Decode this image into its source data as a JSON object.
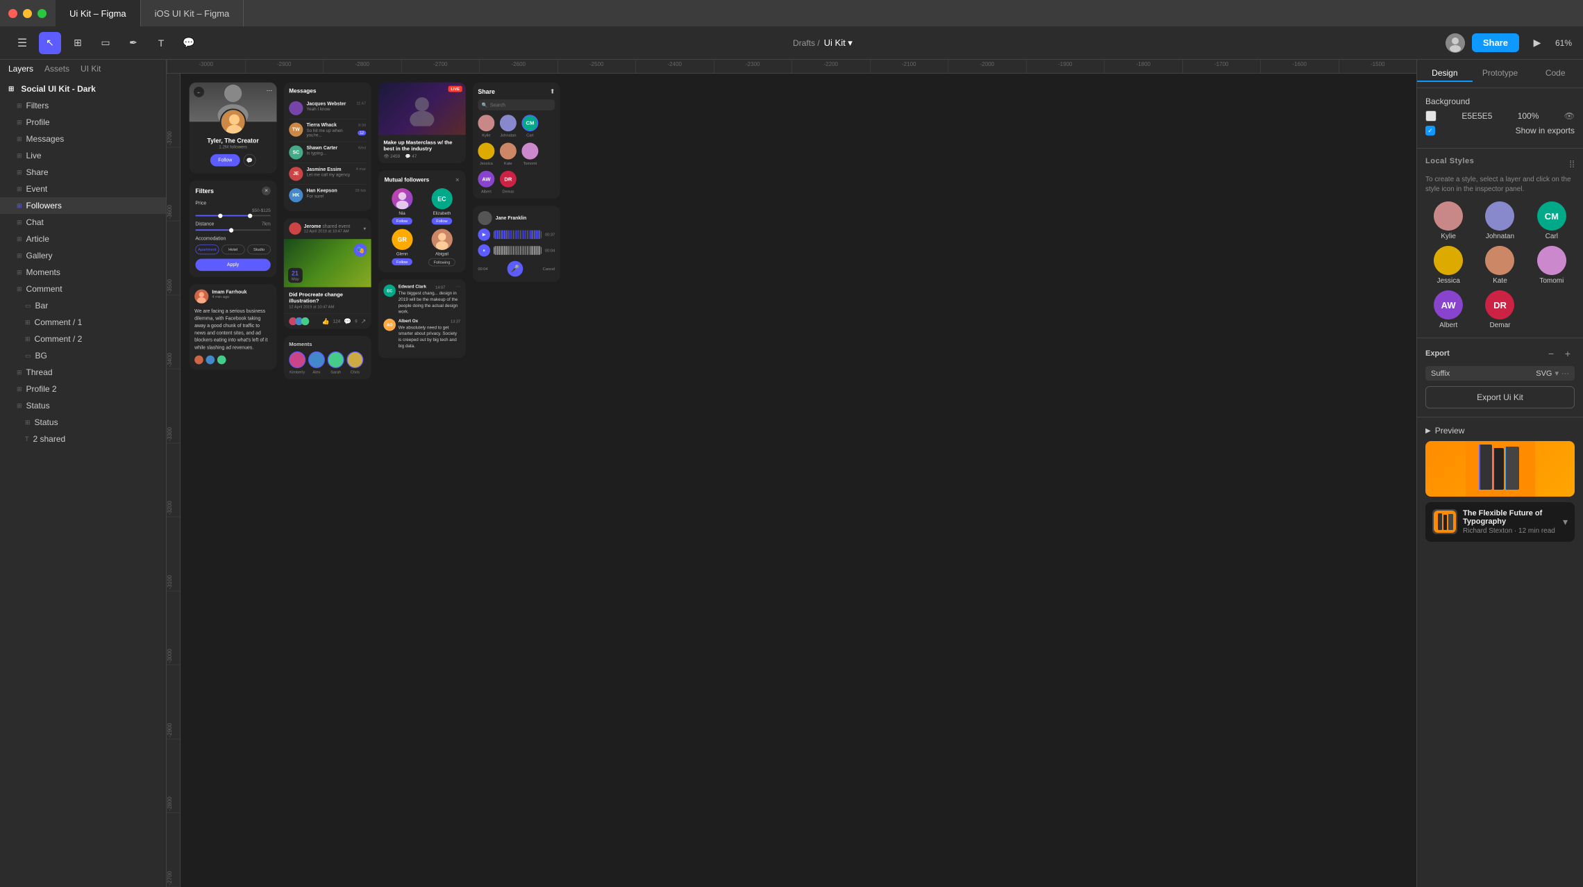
{
  "titlebar": {
    "tab1": "Ui Kit – Figma",
    "tab2": "iOS UI Kit – Figma"
  },
  "toolbar": {
    "title": "Drafts / Ui Kit",
    "share": "Share",
    "zoom": "61%"
  },
  "sidebar": {
    "tabs": [
      "Layers",
      "Assets",
      "UI Kit"
    ],
    "root": "Social UI Kit - Dark",
    "items": [
      "Filters",
      "Profile",
      "Messages",
      "Live",
      "Share",
      "Event",
      "Followers",
      "Chat",
      "Article",
      "Gallery",
      "Moments",
      "Comment",
      "Bar",
      "Comment / 1",
      "Comment / 2",
      "BG",
      "Thread",
      "Profile 2",
      "Status",
      "Status",
      "2 shared"
    ]
  },
  "right_panel": {
    "tabs": [
      "Design",
      "Prototype",
      "Code"
    ],
    "background_label": "Background",
    "color_value": "E5E5E5",
    "opacity": "100%",
    "show_exports": "Show in exports",
    "local_styles": "Local Styles",
    "local_styles_hint": "To create a style, select a layer and click on the style icon in the inspector panel.",
    "people": [
      {
        "name": "Kylie",
        "initials": "",
        "bg": "#c88888"
      },
      {
        "name": "Johnatan",
        "initials": "",
        "bg": "#8888cc"
      },
      {
        "name": "Carl",
        "initials": "CM",
        "bg": "#00aa88"
      },
      {
        "name": "Jessica",
        "initials": "",
        "bg": "#ddaa00"
      },
      {
        "name": "Kate",
        "initials": "",
        "bg": "#cc8866"
      },
      {
        "name": "Tomomi",
        "initials": "",
        "bg": "#cc88aa"
      },
      {
        "name": "Albert",
        "initials": "AW",
        "bg": "#8844cc"
      },
      {
        "name": "Demar",
        "initials": "DR",
        "bg": "#cc2244"
      }
    ],
    "export_label": "Export",
    "suffix_label": "Suffix",
    "format": "SVG",
    "export_btn": "Export Ui Kit",
    "preview_label": "Preview",
    "preview_title": "The Flexible Future of Typography",
    "preview_sub": "Richard Stexton · 12 min read"
  },
  "canvas": {
    "profile": {
      "name": "Tyler, The Creator",
      "followers": "1.2M followers",
      "follow": "Follow"
    },
    "messages": {
      "title": "Messages",
      "items": [
        {
          "name": "Jacques Webster",
          "text": "Yeah I know",
          "time": "11:47"
        },
        {
          "name": "Tierra Whack",
          "text": "So hit me up when you're...",
          "time": "8:30",
          "badge": "12"
        },
        {
          "name": "Shawn Carter",
          "text": "Is typing...",
          "time": "Wed"
        },
        {
          "name": "Jasmine Essim",
          "text": "Let me call my agency",
          "time": "4 mar"
        },
        {
          "name": "Han Keepson",
          "text": "For sure!",
          "time": "28 feb"
        }
      ]
    },
    "filters": {
      "title": "Filters",
      "price_label": "Price",
      "price_value": "$50-$125",
      "distance_label": "Distance",
      "distance_value": "7km",
      "accom_label": "Accomodation",
      "accom_options": [
        "Apartment",
        "Hotel",
        "Studio"
      ],
      "apply": "Apply"
    },
    "live": {
      "title": "Make up Masterclass w/ the best in the industry",
      "badge": "LIVE",
      "views": "2459",
      "comments": "47"
    },
    "followers": {
      "title": "Mutual followers",
      "people": [
        {
          "name": "Nia",
          "initials": "",
          "bg": "#cc44aa",
          "btn": "Follow"
        },
        {
          "name": "Elizabeth",
          "initials": "EC",
          "bg": "#00aa88",
          "btn": "Follow"
        },
        {
          "name": "Glenn",
          "initials": "GR",
          "bg": "#ffaa00",
          "btn": "Follow"
        },
        {
          "name": "Abigail",
          "initials": "",
          "bg": "#cc8866",
          "btn": "Following"
        }
      ]
    },
    "event": {
      "name": "Jerome",
      "action": "shared event",
      "date": "12 April 2019 at 10:47 AM",
      "post_title": "Did Procreate change illustration?",
      "likes": "124",
      "comments": "9",
      "event_day": "21",
      "event_month": "May"
    },
    "thread": {
      "author": "Imam Farrhouk",
      "time": "4 min ago",
      "text": "We are facing a serious business dilemma, with Facebook taking away a good chunk of traffic to news and content sites, and ad blockers eating into what's left of it while slashing ad revenues."
    },
    "chat": {
      "items": [
        {
          "name": "Edward Clark",
          "initials": "EC",
          "bg": "#00aa88",
          "time": "14:07",
          "text": "The biggest chang... design in 2019 will be the makeup of the people doing the actual design work."
        },
        {
          "name": "Albert Ox",
          "initials": "AO",
          "bg": "#ffaa44",
          "time": "13:37",
          "text": "We absolutely need to get smarter about privacy. Society is creeped out by big tech and big data."
        }
      ]
    },
    "share": {
      "title": "Share",
      "search_placeholder": "Search",
      "people": [
        {
          "name": "Kylie",
          "bg": "#c88888"
        },
        {
          "name": "Johnatan",
          "bg": "#8888cc"
        },
        {
          "name": "Carl",
          "initials": "CM",
          "bg": "#00aa88"
        },
        {
          "name": "Jessica",
          "bg": "#ddaa00"
        },
        {
          "name": "Kate",
          "bg": "#cc8866"
        },
        {
          "name": "Tomomi",
          "bg": "#cc88aa"
        }
      ]
    },
    "moments": {
      "title": "Moments",
      "people": [
        "Kimberly",
        "Alex",
        "Sarah",
        "Chris"
      ]
    },
    "audio": {
      "user": "Jane Franklin",
      "time1": "00:37",
      "time2": "00:04",
      "cancel": "Cancel"
    }
  },
  "rulers": [
    "-3000",
    "-2900",
    "-2800",
    "-2700",
    "-2600",
    "-2500",
    "-2400",
    "-2300",
    "-2200",
    "-2100",
    "-2000",
    "-1900",
    "-1800",
    "-1700",
    "-1600",
    "-1500"
  ]
}
